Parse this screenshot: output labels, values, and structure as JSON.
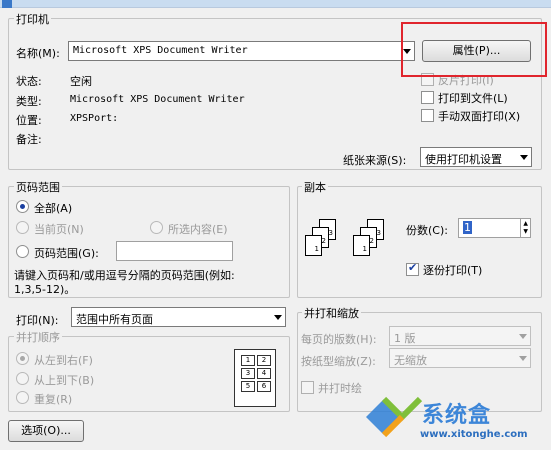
{
  "window": {
    "title": "打印"
  },
  "printer": {
    "group_label": "打印机",
    "name_label": "名称(M):",
    "name_value": "Microsoft XPS Document Writer",
    "properties_button": "属性(P)...",
    "status_label": "状态:",
    "status_value": "空闲",
    "type_label": "类型:",
    "type_value": "Microsoft XPS Document Writer",
    "location_label": "位置:",
    "location_value": "XPSPort:",
    "comment_label": "备注:",
    "reverse_print": "反片打印(I)",
    "print_to_file": "打印到文件(L)",
    "manual_duplex": "手动双面打印(X)",
    "paper_source_label": "纸张来源(S):",
    "paper_source_value": "使用打印机设置"
  },
  "page_range": {
    "group_label": "页码范围",
    "all": "全部(A)",
    "current_page": "当前页(N)",
    "selection": "所选内容(E)",
    "pages": "页码范围(G):",
    "pages_value": "",
    "hint_line1": "请键入页码和/或用逗号分隔的页码范围(例如:",
    "hint_line2": "1,3,5-12)。"
  },
  "copies": {
    "group_label": "副本",
    "count_label": "份数(C):",
    "count_value": "1",
    "collate": "逐份打印(T)"
  },
  "print_what": {
    "label": "打印(N):",
    "value": "范围中所有页面",
    "order_label": "并打顺序",
    "left_to_right": "从左到右(F)",
    "top_to_bottom": "从上到下(B)",
    "repeat": "重复(R)"
  },
  "zoom": {
    "group_label": "并打和缩放",
    "pages_per_sheet_label": "每页的版数(H):",
    "pages_per_sheet_value": "1 版",
    "scale_label": "按纸型缩放(Z):",
    "scale_value": "无缩放",
    "combine_print": "并打时绘"
  },
  "footer": {
    "options_button": "选项(O)..."
  },
  "watermark": {
    "brand": "系统盒",
    "url": "www.xitonghe.com"
  },
  "colors": {
    "highlight_box": "#e0252d",
    "accent": "#1a3fa0"
  }
}
